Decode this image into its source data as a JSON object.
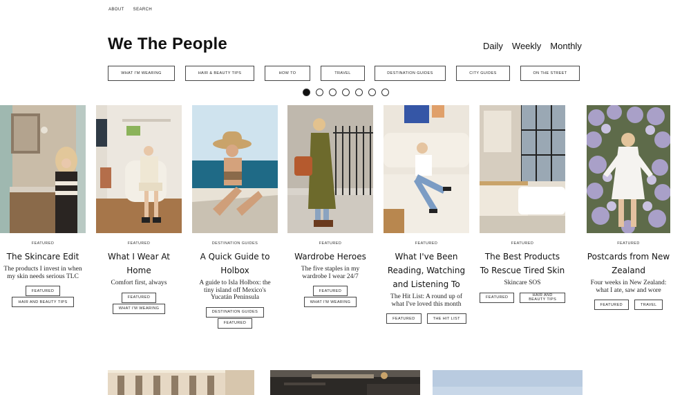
{
  "topnav": {
    "about": "ABOUT",
    "search": "SEARCH"
  },
  "site": {
    "title": "We The People"
  },
  "period_tabs": {
    "daily": "Daily",
    "weekly": "Weekly",
    "monthly": "Monthly"
  },
  "categories": [
    "WHAT I'M WEARING",
    "HAIR & BEAUTY TIPS",
    "HOW TO",
    "TRAVEL",
    "DESTINATION GUIDES",
    "CITY GUIDES",
    "ON THE STREET"
  ],
  "carousel": {
    "slide_count": 7,
    "active_index": 0
  },
  "cards": [
    {
      "kicker": "FEATURED",
      "title": "The Skincare Edit",
      "excerpt": "The products I invest in when my skin needs serious TLC",
      "tags": [
        [
          "FEATURED"
        ],
        [
          "HAIR AND BEAUTY TIPS"
        ]
      ]
    },
    {
      "kicker": "FEATURED",
      "title": "What I Wear At Home",
      "excerpt": "Comfort first, always",
      "tags": [
        [
          "FEATURED"
        ],
        [
          "WHAT I'M WEARING"
        ]
      ]
    },
    {
      "kicker": "DESTINATION GUIDES",
      "title": "A Quick Guide to Holbox",
      "excerpt": "A guide to Isla Holbox: the tiny island off Mexico's Yucatán Peninsula",
      "tags": [
        [
          "DESTINATION GUIDES"
        ],
        [
          "FEATURED"
        ]
      ]
    },
    {
      "kicker": "FEATURED",
      "title": "Wardrobe Heroes",
      "excerpt": "The five staples in my wardrobe I wear 24/7",
      "tags": [
        [
          "FEATURED"
        ],
        [
          "WHAT I'M WEARING"
        ]
      ]
    },
    {
      "kicker": "FEATURED",
      "title": "What I've Been Reading, Watching and Listening To",
      "excerpt": "The Hit List: A round up of what I've loved this month",
      "tags": [
        [
          "FEATURED",
          "THE HIT LIST"
        ]
      ]
    },
    {
      "kicker": "FEATURED",
      "title": "The Best Products To Rescue Tired Skin",
      "excerpt": "Skincare SOS",
      "tags": [
        [
          "FEATURED",
          "HAIR AND BEAUTY TIPS"
        ]
      ]
    },
    {
      "kicker": "FEATURED",
      "title": "Postcards from New Zealand",
      "excerpt": "Four weeks in New Zealand: what I ate, saw and wore",
      "tags": [
        [
          "FEATURED",
          "TRAVEL"
        ]
      ]
    }
  ]
}
